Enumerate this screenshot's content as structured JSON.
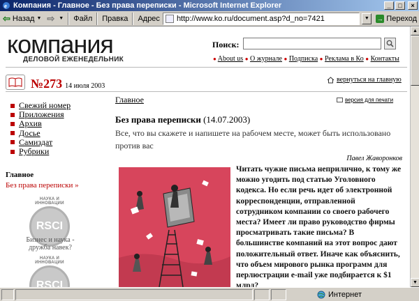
{
  "browser": {
    "title": "Компания - Главное - Без права переписки - Microsoft Internet Explorer",
    "toolbar": {
      "back_label": "Назад",
      "file_label": "Файл",
      "edit_label": "Правка",
      "address_label": "Адрес",
      "url": "http://www.ko.ru/document.asp?d_no=7421",
      "go_label": "Переход"
    },
    "status": {
      "zone_label": "Интернет"
    }
  },
  "site": {
    "logo_text": "компания",
    "tagline": "ДЕЛОВОЙ ЕЖЕНЕДЕЛЬНИК",
    "search_label": "Поиск:",
    "top_links": [
      "About us",
      "О журнале",
      "Подписка",
      "Реклама в Ко",
      "Контакты"
    ],
    "issue_number": "№273",
    "issue_date": "14 июля 2003",
    "back_to_main": "вернуться на главную"
  },
  "sidebar": {
    "items": [
      {
        "label": "Свежий номер"
      },
      {
        "label": "Приложения"
      },
      {
        "label": "Архив"
      },
      {
        "label": "Досье"
      },
      {
        "label": "Самиздат"
      },
      {
        "label": "Рубрики"
      }
    ],
    "crumb_heading": "Главное",
    "crumb_current": "Без права переписки »",
    "badge_top_label": "НАУКА И ИННОВАЦИИ",
    "badge_text": "RSCI",
    "badge_caption": "Бизнес и наука - дружба навек?",
    "badge2_label": "НАУКА И ИННОВАЦИИ",
    "badge2_text": "RSCI"
  },
  "article": {
    "section": "Главное",
    "print_label": "версия для печати",
    "title": "Без права переписки",
    "date": "(14.07.2003)",
    "lead": "Все, что вы скажете и напишете на рабочем месте, может быть использовано против вас",
    "author": "Павел Жаворонков",
    "body": "Читать чужие письма неприлично, к тому же можно угодить под статью Уголовного кодекса. Но если речь идет об электронной корреспонденции, отправленной сотрудником компании со своего рабочего места? Имеет ли право руководство фирмы просматривать такие письма? В большинстве компаний на этот вопрос дают положительный ответ. Иначе как объяснить, что объем мирового рынка программ для перлюстрации e-mail уже подбирается к $1 млрд?"
  },
  "colors": {
    "accent_red": "#b00000",
    "illustration_bg": "#d7455c",
    "titlebar_start": "#0a246a"
  }
}
